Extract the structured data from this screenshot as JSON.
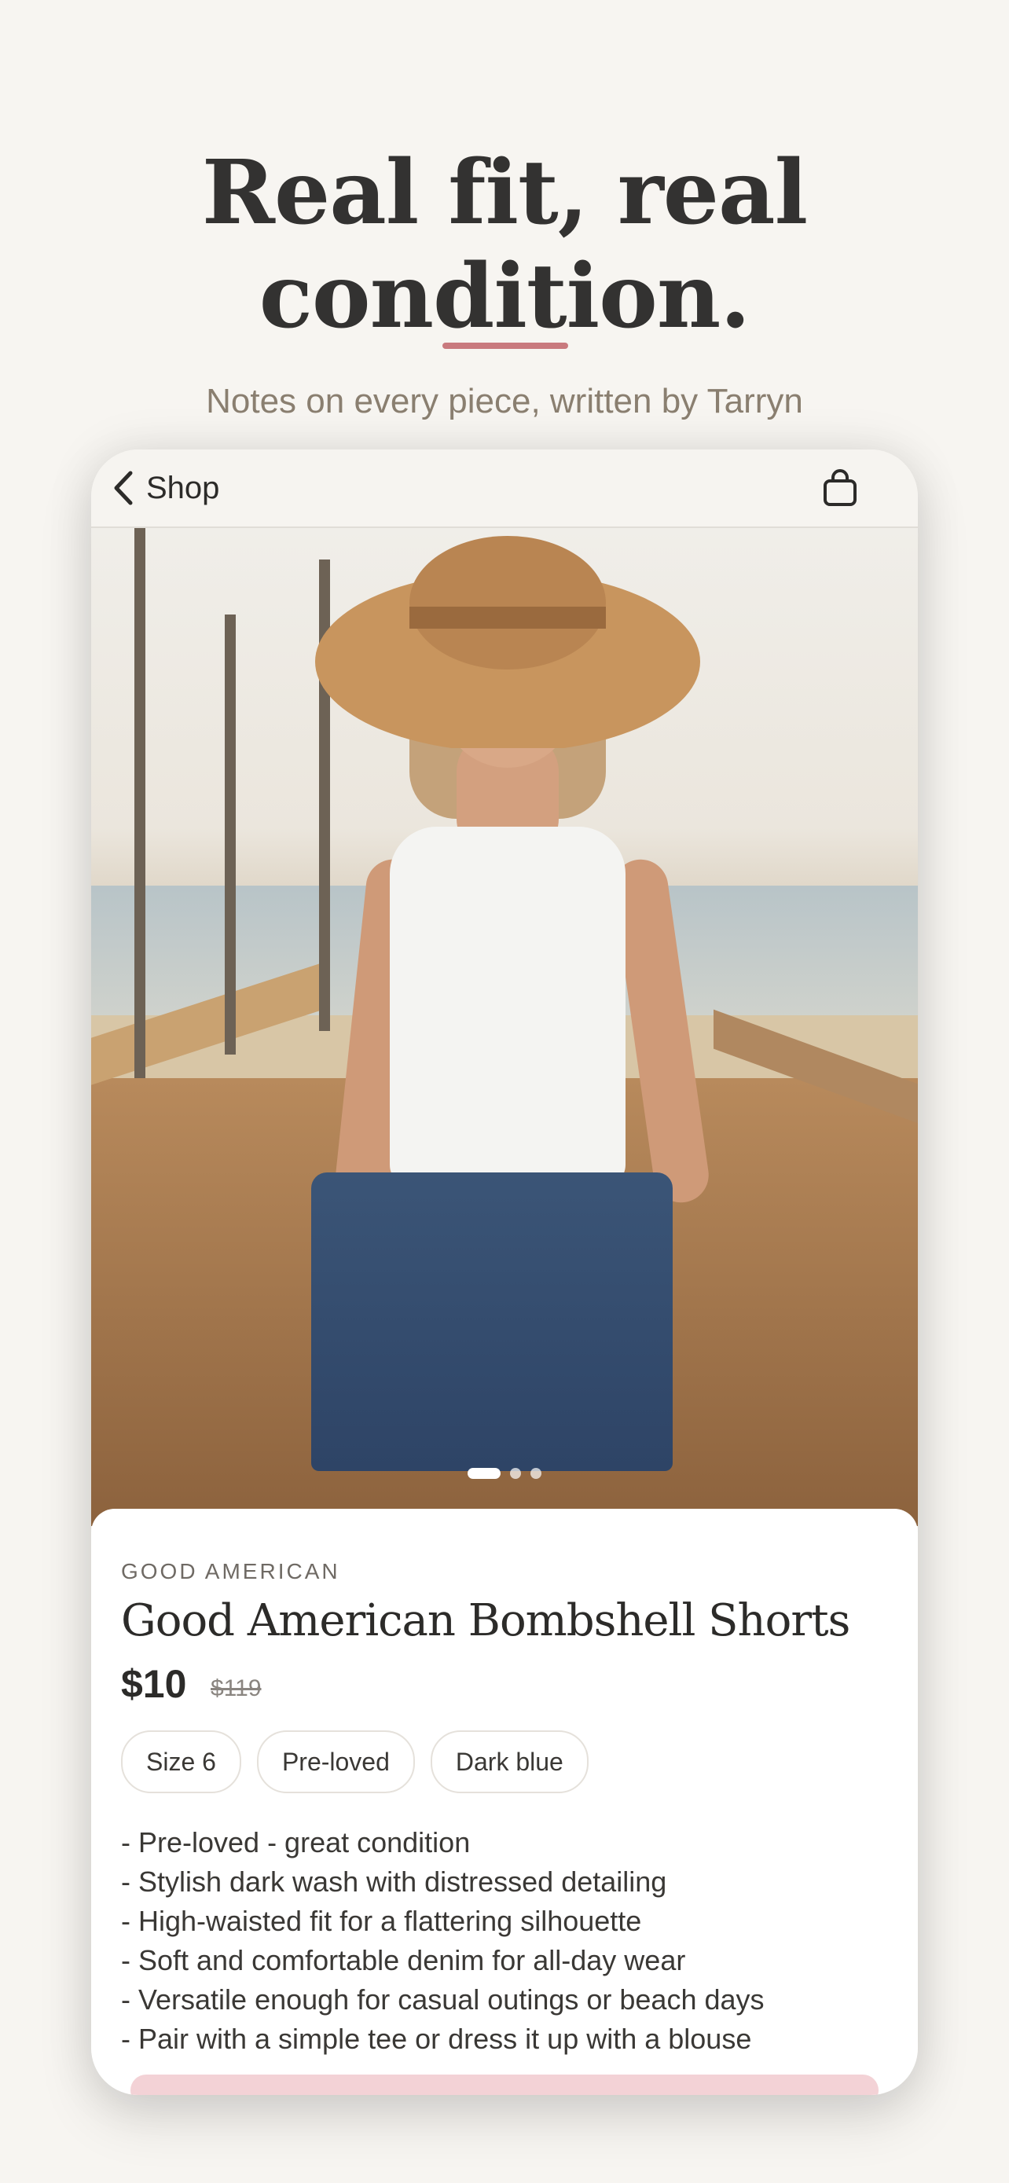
{
  "header": {
    "headline_line1": "Real fit, real",
    "headline_line2": "condition.",
    "subtitle": "Notes on every piece, written by Tarryn"
  },
  "navbar": {
    "back_label": "Shop",
    "back_icon": "chevron-left-icon",
    "bag_icon": "shopping-bag-icon"
  },
  "gallery": {
    "image_count": 3,
    "active_index": 0
  },
  "product": {
    "brand": "GOOD AMERICAN",
    "title": "Good American Bombshell Shorts",
    "price": "$10",
    "original_price": "$119",
    "tags": [
      "Size 6",
      "Pre-loved",
      "Dark blue"
    ],
    "notes": [
      "- Pre-loved - great condition",
      "- Stylish dark wash with distressed detailing",
      "- High-waisted fit for a flattering silhouette",
      "- Soft and comfortable denim for all-day wear",
      "- Versatile enough for casual outings or beach days",
      "- Pair with a simple tee or dress it up with a blouse"
    ]
  },
  "colors": {
    "accent": "#c97a7e",
    "background": "#f7f5f1",
    "text": "#333231"
  }
}
